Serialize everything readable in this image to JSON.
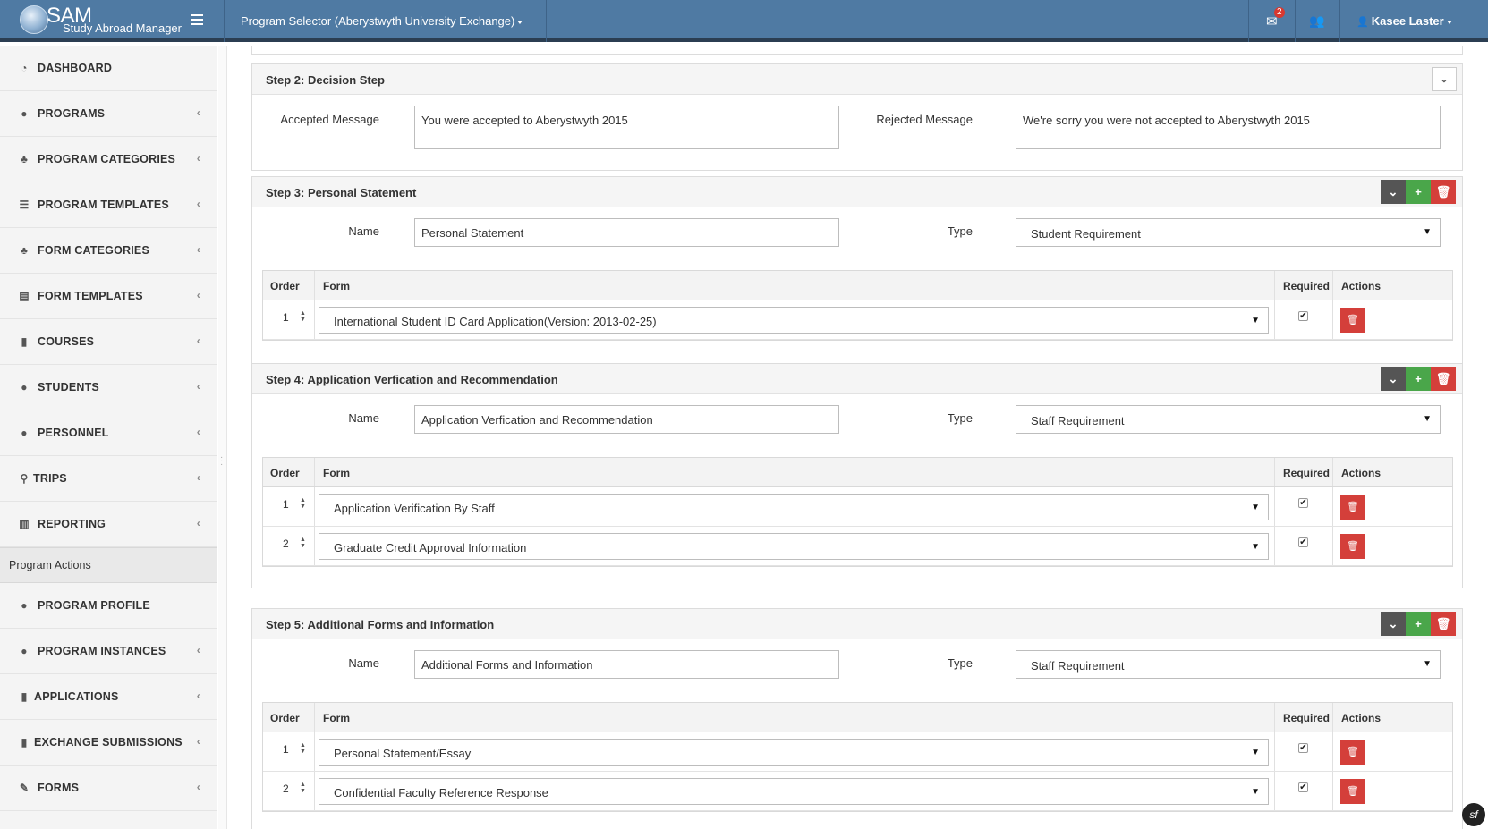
{
  "header": {
    "logo_text": "SAM",
    "logo_sub": "Study Abroad Manager",
    "program_selector": "Program Selector (Aberystwyth University Exchange)",
    "mail_badge": "2",
    "user_name": "Kasee Laster"
  },
  "sidebar": {
    "items": [
      {
        "label": "DASHBOARD",
        "icon": "dashboard-icon"
      },
      {
        "label": "PROGRAMS",
        "icon": "globe-icon"
      },
      {
        "label": "PROGRAM CATEGORIES",
        "icon": "sitemap-icon"
      },
      {
        "label": "PROGRAM TEMPLATES",
        "icon": "list-icon"
      },
      {
        "label": "FORM CATEGORIES",
        "icon": "sitemap-icon"
      },
      {
        "label": "FORM TEMPLATES",
        "icon": "list-alt-icon"
      },
      {
        "label": "COURSES",
        "icon": "book-icon"
      },
      {
        "label": "STUDENTS",
        "icon": "users-icon"
      },
      {
        "label": "PERSONNEL",
        "icon": "users-icon"
      },
      {
        "label": "TRIPS",
        "icon": "map-marker-icon"
      },
      {
        "label": "REPORTING",
        "icon": "bar-chart-icon"
      }
    ],
    "section_title": "Program Actions",
    "action_items": [
      {
        "label": "PROGRAM PROFILE",
        "icon": "info-icon"
      },
      {
        "label": "PROGRAM INSTANCES",
        "icon": "globe-icon"
      },
      {
        "label": "APPLICATIONS",
        "icon": "file-icon"
      },
      {
        "label": "EXCHANGE SUBMISSIONS",
        "icon": "file-icon"
      },
      {
        "label": "FORMS",
        "icon": "edit-icon"
      }
    ]
  },
  "labels": {
    "name": "Name",
    "type": "Type",
    "order": "Order",
    "form": "Form",
    "required": "Required",
    "actions": "Actions",
    "accepted_message": "Accepted Message",
    "rejected_message": "Rejected Message"
  },
  "step2": {
    "title": "Step 2: Decision Step",
    "accepted_value": "You were accepted to Aberystwyth 2015",
    "rejected_value": "We're sorry you were not accepted to Aberystwyth 2015"
  },
  "step3": {
    "title": "Step 3: Personal Statement",
    "name": "Personal Statement",
    "type": "Student Requirement",
    "rows": [
      {
        "order": "1",
        "form": "International Student ID Card Application(Version: 2013-02-25)"
      }
    ]
  },
  "step4": {
    "title": "Step 4: Application Verfication and Recommendation",
    "name": "Application Verfication and Recommendation",
    "type": "Staff Requirement",
    "rows": [
      {
        "order": "1",
        "form": "Application Verification By Staff"
      },
      {
        "order": "2",
        "form": "Graduate Credit Approval Information"
      }
    ]
  },
  "step5": {
    "title": "Step 5: Additional Forms and Information",
    "name": "Additional Forms and Information",
    "type": "Staff Requirement",
    "rows": [
      {
        "order": "1",
        "form": "Personal Statement/Essay"
      },
      {
        "order": "2",
        "form": "Confidential Faculty Reference Response"
      }
    ]
  },
  "colors": {
    "header": "#4f7aa3",
    "danger": "#d43f3a",
    "success": "#4aa64a",
    "dark": "#555555"
  }
}
